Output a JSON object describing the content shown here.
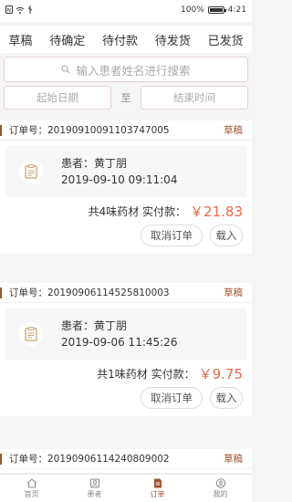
{
  "status_bar": {
    "battery": "100%",
    "battery_level": 1.0,
    "time": "4:21"
  },
  "tabs": [
    {
      "label": "草稿",
      "active": true
    },
    {
      "label": "待确定",
      "active": false
    },
    {
      "label": "待付款",
      "active": false
    },
    {
      "label": "待发货",
      "active": false
    },
    {
      "label": "已发货",
      "active": false
    }
  ],
  "search": {
    "placeholder": "输入患者姓名进行搜索"
  },
  "date_filter": {
    "start_placeholder": "起始日期",
    "separator": "至",
    "end_placeholder": "结束时间"
  },
  "orders": [
    {
      "order_label": "订单号：20190910091103747005",
      "status": "草稿",
      "patient": "患者：黄丁朋",
      "time": "2019-09-10 09:11:04",
      "summary": "共4味药材  实付款：",
      "price": "￥21.83",
      "cancel_label": "取消订单",
      "load_label": "载入"
    },
    {
      "order_label": "订单号：20190906114525810003",
      "status": "草稿",
      "patient": "患者：黄丁朋",
      "time": "2019-09-06 11:45:26",
      "summary": "共1味药材  实付款：",
      "price": "￥9.75",
      "cancel_label": "取消订单",
      "load_label": "载入"
    },
    {
      "order_label": "订单号：20190906114240809002",
      "status": "草稿"
    }
  ],
  "bottom_nav": [
    {
      "label": "首页",
      "icon": "home-icon",
      "active": false
    },
    {
      "label": "患者",
      "icon": "patient-icon",
      "active": false
    },
    {
      "label": "订单",
      "icon": "order-icon",
      "active": true
    },
    {
      "label": "我的",
      "icon": "profile-icon",
      "active": false
    }
  ],
  "colors": {
    "accent": "#a0522d",
    "price": "#e86a4a",
    "background": "#f5f5f5"
  }
}
